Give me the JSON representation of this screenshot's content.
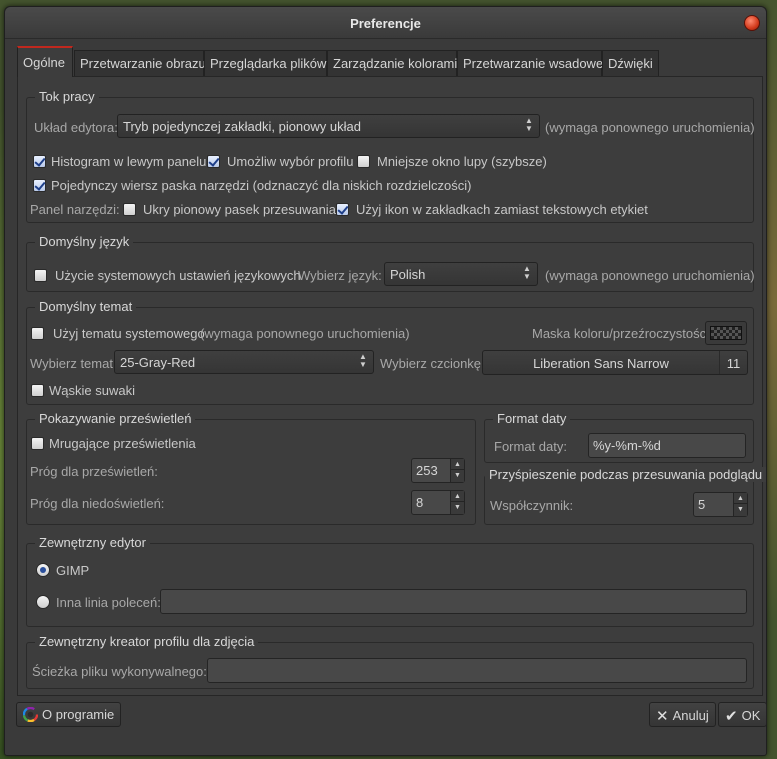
{
  "window": {
    "title": "Preferencje"
  },
  "tabs": [
    "Ogólne",
    "Przetwarzanie obrazu",
    "Przeglądarka plików",
    "Zarządzanie kolorami",
    "Przetwarzanie wsadowe",
    "Dźwięki"
  ],
  "workflow": {
    "label": "Tok pracy",
    "editor_layout_label": "Układ edytora:",
    "editor_layout_value": "Tryb pojedynczej zakładki, pionowy układ",
    "restart_note": "(wymaga ponownego uruchomienia)",
    "histogram_left": {
      "label": "Histogram w lewym panelu",
      "checked": true
    },
    "profile_select": {
      "label": "Umożliw wybór profilu",
      "checked": true
    },
    "smaller_loupe": {
      "label": "Mniejsze okno lupy (szybsze)",
      "checked": false
    },
    "single_toolbar": {
      "label": "Pojedynczy wiersz paska narzędzi (odznaczyć dla niskich rozdzielczości)",
      "checked": true
    },
    "toolpanel_label": "Panel narzędzi:",
    "hide_vscroll": {
      "label": "Ukry pionowy pasek przesuwania",
      "checked": false
    },
    "use_icons": {
      "label": "Użyj ikon w zakładkach zamiast tekstowych etykiet",
      "checked": true
    }
  },
  "language": {
    "label": "Domyślny język",
    "use_system": {
      "label": "Użycie systemowych ustawień językowych",
      "checked": false
    },
    "select_label": "Wybierz język:",
    "select_value": "Polish",
    "restart_note": "(wymaga ponownego uruchomienia)"
  },
  "theme": {
    "label": "Domyślny temat",
    "use_system": {
      "label": "Użyj tematu systemowego",
      "checked": false
    },
    "restart_note": "(wymaga ponownego uruchomienia)",
    "mask_label": "Maska koloru/przeźroczystości:",
    "select_theme_label": "Wybierz temat:",
    "select_theme_value": "25-Gray-Red",
    "select_font_label": "Wybierz czcionkę:",
    "font_name": "Liberation Sans Narrow",
    "font_size": "11",
    "narrow_sliders": {
      "label": "Wąskie suwaki",
      "checked": false
    }
  },
  "clipping": {
    "label": "Pokazywanie prześwietleń",
    "blink": {
      "label": "Mrugające prześwietlenia",
      "checked": false
    },
    "highlight_label": "Próg dla prześwietleń:",
    "highlight_value": "253",
    "shadow_label": "Próg dla niedoświetleń:",
    "shadow_value": "8"
  },
  "date_format": {
    "label": "Format daty",
    "field_label": "Format daty:",
    "field_value": "%y-%m-%d"
  },
  "pan_accel": {
    "label": "Przyśpieszenie podczas przesuwania podglądu",
    "factor_label": "Współczynnik:",
    "factor_value": "5"
  },
  "external_editor": {
    "label": "Zewnętrzny edytor",
    "gimp": {
      "label": "GIMP",
      "selected": true
    },
    "other": {
      "label": "Inna linia poleceń:",
      "selected": false
    },
    "other_value": ""
  },
  "profile_creator": {
    "label": "Zewnętrzny kreator profilu dla zdjęcia",
    "path_label": "Ścieżka pliku wykonywalnego:",
    "path_value": ""
  },
  "buttons": {
    "about": "O programie",
    "cancel": "Anuluj",
    "ok": "OK"
  },
  "colors": {
    "accent_tab": "#c0281e",
    "window_bg": "#3a3a3a",
    "check_blue": "#1e3f8a"
  }
}
